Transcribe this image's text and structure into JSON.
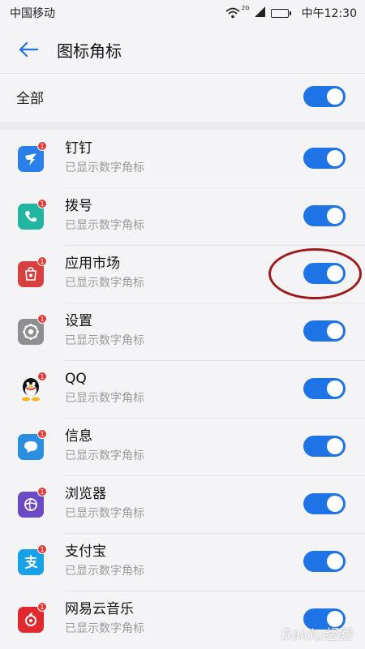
{
  "status": {
    "carrier": "中国移动",
    "network": "2G",
    "time": "中午12:30"
  },
  "header": {
    "title": "图标角标"
  },
  "all_toggle": {
    "label": "全部",
    "on": true
  },
  "apps": [
    {
      "name": "钉钉",
      "subtitle": "已显示数字角标",
      "badge": "1",
      "icon": "dingtalk-icon",
      "color": "#2a7fe9",
      "on": true
    },
    {
      "name": "拨号",
      "subtitle": "已显示数字角标",
      "badge": "1",
      "icon": "phone-icon",
      "color": "#22b6a1",
      "on": true
    },
    {
      "name": "应用市场",
      "subtitle": "已显示数字角标",
      "badge": "1",
      "icon": "app-market-icon",
      "color": "#d64040",
      "on": true
    },
    {
      "name": "设置",
      "subtitle": "已显示数字角标",
      "badge": "1",
      "icon": "settings-icon",
      "color": "#8e8e93",
      "on": true
    },
    {
      "name": "QQ",
      "subtitle": "已显示数字角标",
      "badge": "1",
      "icon": "qq-icon",
      "color": "#ffffff",
      "on": true
    },
    {
      "name": "信息",
      "subtitle": "已显示数字角标",
      "badge": "1",
      "icon": "message-icon",
      "color": "#2a8fe0",
      "on": true
    },
    {
      "name": "浏览器",
      "subtitle": "已显示数字角标",
      "badge": "1",
      "icon": "browser-icon",
      "color": "#6a4bc4",
      "on": true
    },
    {
      "name": "支付宝",
      "subtitle": "已显示数字角标",
      "badge": "1",
      "icon": "alipay-icon",
      "color": "#18a0e8",
      "on": true
    },
    {
      "name": "网易云音乐",
      "subtitle": "已显示数字角标",
      "badge": "1",
      "icon": "netease-music-icon",
      "color": "#e0282f",
      "on": true
    }
  ],
  "watermark": "Baidu经验"
}
